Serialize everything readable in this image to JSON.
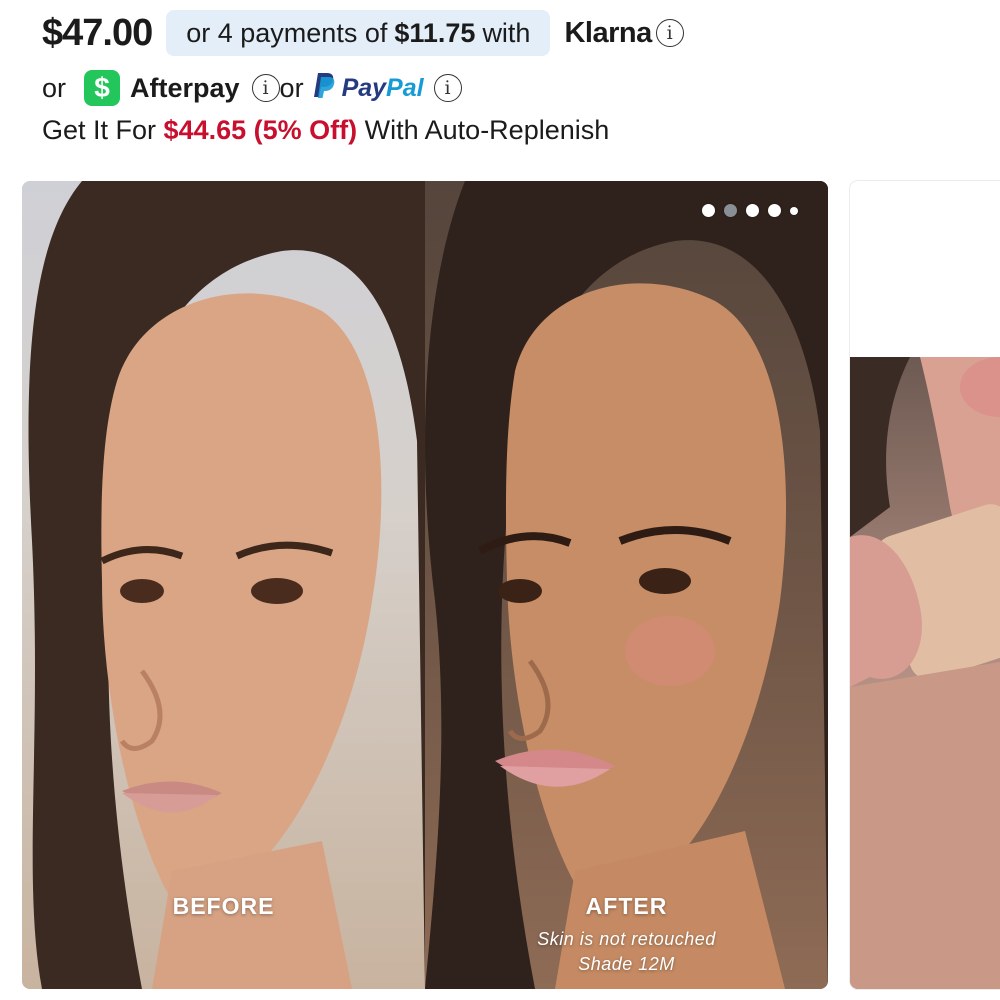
{
  "price": {
    "main": "$47.00",
    "klarna_prefix": "or 4 payments of",
    "klarna_amount": "$11.75",
    "klarna_suffix": "with",
    "klarna_brand": "Klarna"
  },
  "payment_options": {
    "or1": "or",
    "cashapp_symbol": "$",
    "afterpay": "Afterpay",
    "or2": "or",
    "paypal_pay": "Pay",
    "paypal_pal": "Pal"
  },
  "info_glyph": "i",
  "auto_replenish": {
    "prefix": "Get It For",
    "deal": "$44.65 (5% Off)",
    "suffix": "With Auto-Replenish"
  },
  "gallery": {
    "before_label": "BEFORE",
    "after_label": "AFTER",
    "after_note": "Skin is not retouched",
    "after_shade": "Shade 12M",
    "slide_index": 1,
    "slide_count": 5
  },
  "icons": {
    "cashapp": "cashapp-icon",
    "paypal": "paypal-icon",
    "info": "info-icon"
  },
  "colors": {
    "deal_red": "#c8102e",
    "klarna_bg": "#e3eef9",
    "cashapp_green": "#22c65a",
    "paypal_dark": "#253b80",
    "paypal_light": "#179bd7"
  }
}
